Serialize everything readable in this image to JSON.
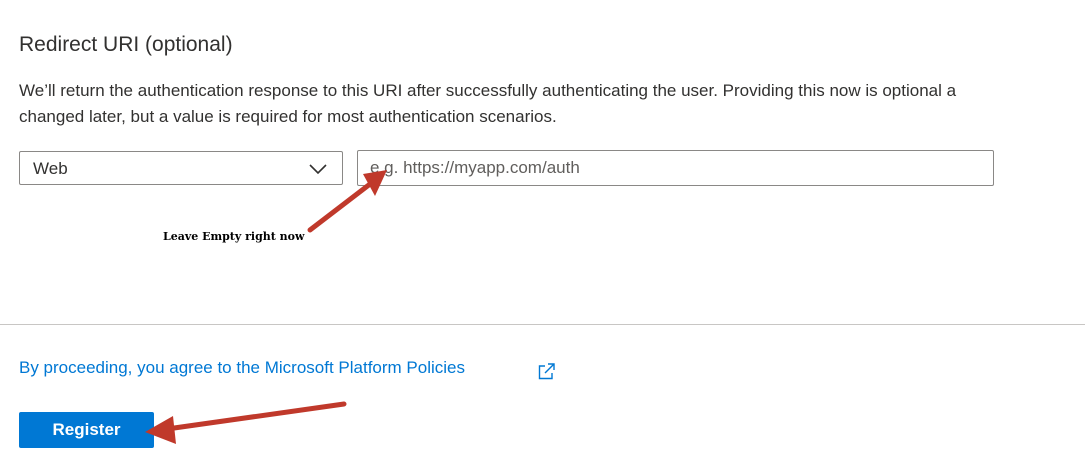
{
  "redirect_uri": {
    "title": "Redirect URI (optional)",
    "description_line1": "We’ll return the authentication response to this URI after successfully authenticating the user. Providing this now is optional a",
    "description_line2": "changed later, but a value is required for most authentication scenarios.",
    "platform_select": {
      "value": "Web",
      "icon": "chevron-down-icon"
    },
    "uri_input": {
      "value": "",
      "placeholder": "e.g. https://myapp.com/auth"
    }
  },
  "annotations": {
    "note": "Leave Empty right now",
    "arrow_color": "#c0392b"
  },
  "footer": {
    "policy_link": "By proceeding, you agree to the Microsoft Platform Policies",
    "policy_icon": "external-link-icon",
    "register_label": "Register"
  },
  "colors": {
    "accent": "#0078d4",
    "text": "#323130",
    "border": "#8a8886",
    "divider": "#c8c6c4"
  }
}
